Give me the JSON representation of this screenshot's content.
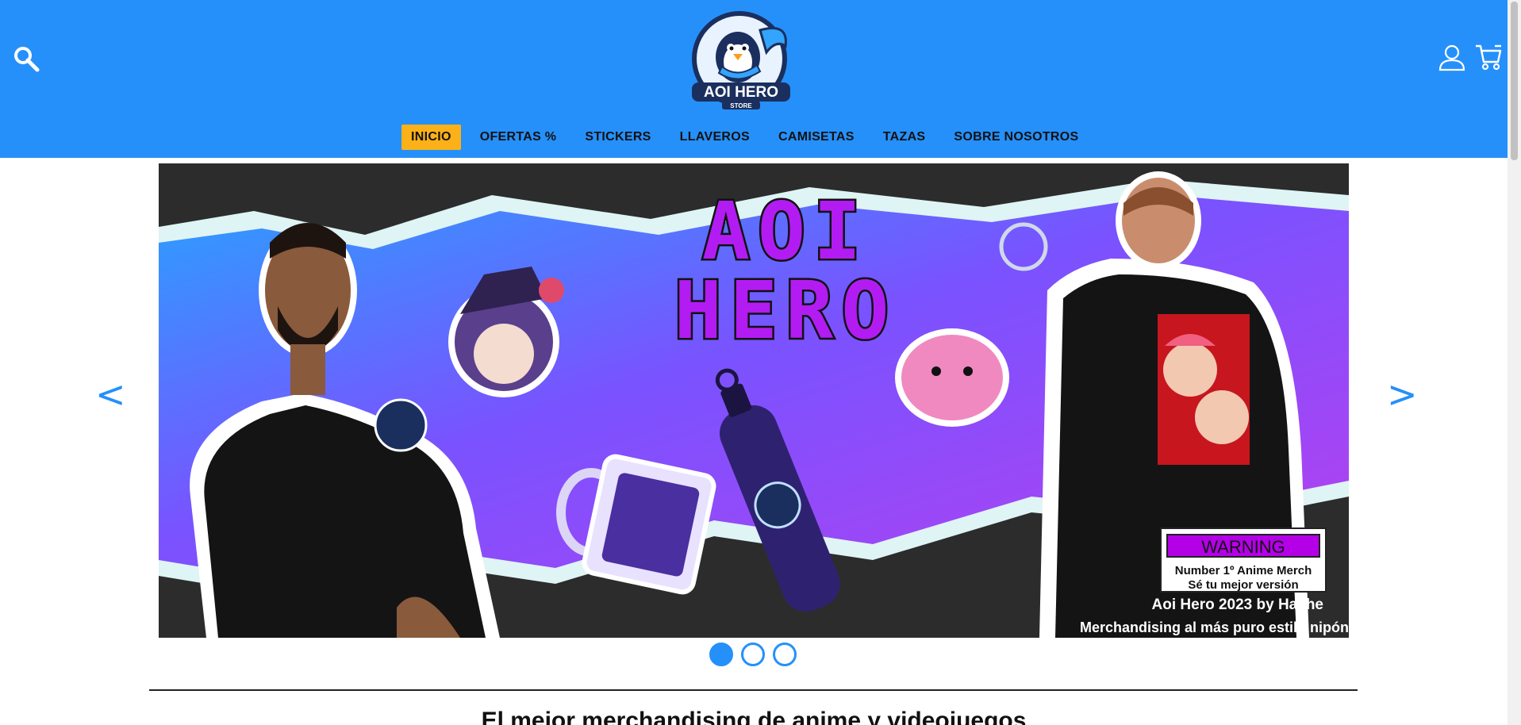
{
  "header": {
    "logo_main": "AOI HERO",
    "logo_sub": "STORE",
    "search_icon": "search-icon",
    "user_icon": "user-icon",
    "cart_icon": "cart-icon"
  },
  "nav": {
    "items": [
      {
        "label": "INICIO",
        "active": true
      },
      {
        "label": "OFERTAS %"
      },
      {
        "label": "STICKERS"
      },
      {
        "label": "LLAVEROS"
      },
      {
        "label": "CAMISETAS"
      },
      {
        "label": "TAZAS"
      },
      {
        "label": "SOBRE NOSOTROS"
      }
    ]
  },
  "carousel": {
    "prev": "<",
    "next": ">",
    "slide": {
      "title_line1": "AOI",
      "title_line2": "HERO",
      "warning_title": "WARNING",
      "warning_line1": "Number 1º Anime Merch",
      "warning_line2": "Sé tu mejor versión",
      "credit": "Aoi Hero 2023 by Hache",
      "tagline": "Merchandising al más puro estilo nipón"
    },
    "dots": 3,
    "active_dot": 0
  },
  "main": {
    "section_title": "El mejor merchandising de anime y videojuegos"
  },
  "colors": {
    "header_bg": "#2590fa",
    "nav_active_bg": "#fbb117",
    "accent": "#2590fa"
  }
}
